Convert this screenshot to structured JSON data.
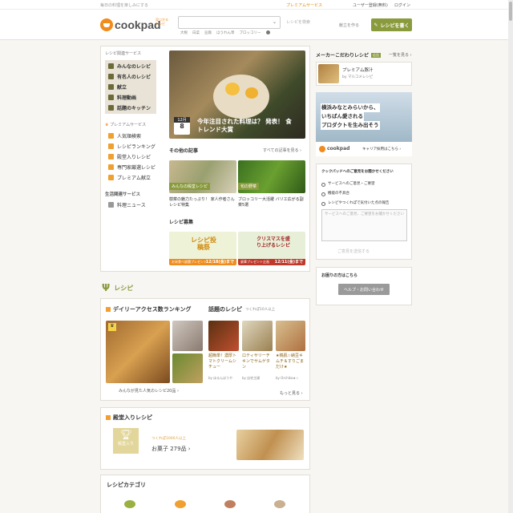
{
  "topbar": {
    "tagline": "毎日の料理を楽しみにする",
    "premium": "プレミアムサービス",
    "register": "ユーザー登録(無料)",
    "login": "ログイン"
  },
  "header": {
    "logo": "cookpad",
    "logo_badge": "見つかる\nレシピ",
    "search_placeholder": "",
    "search_side": "レシピを検索",
    "search_keywords": [
      "大根",
      "白菜",
      "豆腐",
      "ほうれん草",
      "ブロッコリー"
    ],
    "kondate": "献立を作る",
    "write_recipe": "レシピを書く"
  },
  "sidebar": {
    "section1": "レシピ関連サービス",
    "items1": [
      {
        "label": "みんなのレシピ",
        "icon": "fork-knife-icon"
      },
      {
        "label": "有名人のレシピ",
        "icon": "star-person-icon"
      },
      {
        "label": "献立",
        "icon": "menu-icon"
      },
      {
        "label": "料理動画",
        "icon": "video-icon"
      },
      {
        "label": "話題のキッチン",
        "icon": "kitchen-icon"
      }
    ],
    "section2": "プレミアムサービス",
    "items2": [
      {
        "label": "人気順検索",
        "icon": "crown-icon"
      },
      {
        "label": "レシピランキング",
        "icon": "ranking-icon"
      },
      {
        "label": "殿堂入りレシピ",
        "icon": "trophy-icon"
      },
      {
        "label": "専門家厳選レシピ",
        "icon": "expert-icon"
      },
      {
        "label": "プレミアム献立",
        "icon": "premium-menu-icon"
      }
    ],
    "section3": "生活関連サービス",
    "items3": [
      {
        "label": "料理ニュース",
        "icon": "news-icon"
      }
    ]
  },
  "feature": {
    "date_month": "12月",
    "date_day": "8",
    "title": "今年注目された料理は？ 発表！ 食トレンド大賞"
  },
  "other_articles": {
    "heading": "その他の記事",
    "more": "すべての記事を見る ›",
    "items": [
      {
        "tag": "みんなの殿堂レシピ",
        "title": "樹菜の魅力たっぷり！ 家人作者さんレシピ特集"
      },
      {
        "tag": "旬の野菜",
        "title": "ブロッコリー大活躍 バリエ広がる副菜5選"
      }
    ]
  },
  "recipe_contests": {
    "heading": "レシピ募集",
    "items": [
      {
        "title": "レシピ投稿祭",
        "deadline": "12/18(金)まで",
        "note": "お米食べ放題プレゼント"
      },
      {
        "title": "クリスマスを盛り上げるレシピ",
        "deadline": "12/11(金)まで",
        "note": "豪華プレゼント企画"
      }
    ]
  },
  "recipe_section": {
    "heading": "レシピ"
  },
  "daily_ranking": {
    "heading": "デイリーアクセス数ランキング",
    "footer": "みんなが見た人気のレシピ20品 ›"
  },
  "trending": {
    "heading": "話題のレシピ",
    "sub": "つくれぽ10人以上",
    "items": [
      {
        "title": "超簡単！濃厚トマトクリームシチュー",
        "author": "by ほるんぼうや"
      },
      {
        "title": "ロティサリーチキンでサムゲタン",
        "author": "by 自宅主婦"
      },
      {
        "title": "★鶏肌☆納豆キムチ＆すりごまだけ★",
        "author": "by Orchika★☆"
      }
    ],
    "more": "もっと見る ›"
  },
  "hall_of_fame": {
    "heading": "殿堂入りレシピ",
    "badge": "殿堂入り",
    "sub": "つくれぽ1000人以上",
    "category": "お菓子 279品 ›"
  },
  "categories": {
    "heading": "レシピカテゴリ"
  },
  "right": {
    "maker_heading": "メーカーこだわりレシピ",
    "maker_tag": "広告",
    "maker_more": "一覧を見る ›",
    "maker_item_title": "プレミアム豚汁",
    "maker_item_author": "by マルコメレシピ",
    "career_line1": "横浜みなとみらいから、",
    "career_line2": "いちばん愛される",
    "career_line3": "プロダクトを生み出そう",
    "career_logo": "cookpad",
    "career_link": "キャリア採用はこちら ›",
    "feedback_heading": "クックパッドへのご意見をお聞かせください",
    "feedback_options": [
      "サービスへのご意見・ご要望",
      "機能の不具合",
      "レシピやつくれぽで気付いた点の報告"
    ],
    "feedback_placeholder": "サービスへのご意見、ご要望をお聞かせください",
    "feedback_submit": "ご意見を送信する",
    "help_heading": "お困りの方はこちら",
    "help_button": "ヘルプ・お問い合わせ"
  },
  "colors": {
    "accent_green": "#8a9b3d",
    "brand_orange": "#f08b1d",
    "contest_red": "#c0392b"
  }
}
